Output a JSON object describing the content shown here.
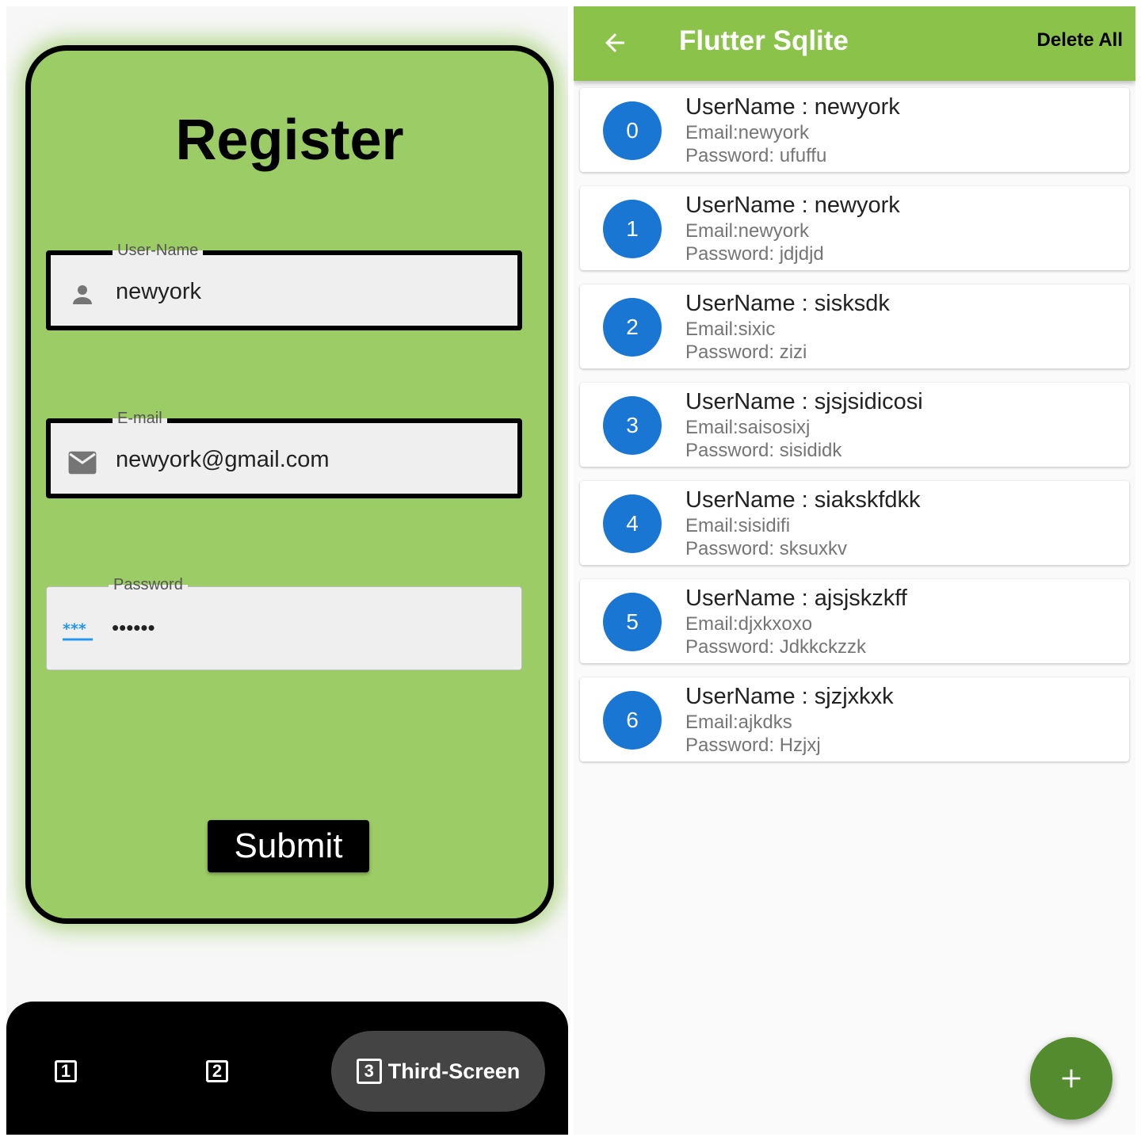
{
  "register": {
    "title": "Register",
    "fields": [
      {
        "label": "User-Name",
        "value": "newyork",
        "icon": "person-icon"
      },
      {
        "label": "E-mail",
        "value": "newyork@gmail.com",
        "icon": "email-icon"
      },
      {
        "label": "Password",
        "value": "••••••",
        "icon": "password-icon"
      }
    ],
    "submit_label": "Submit"
  },
  "bottom_nav": {
    "items": [
      {
        "badge": "1"
      },
      {
        "badge": "2"
      },
      {
        "badge": "3",
        "label": "Third-Screen",
        "active": true
      }
    ]
  },
  "app_bar": {
    "title": "Flutter Sqlite",
    "action_label": "Delete All"
  },
  "users": [
    {
      "index": "0",
      "name": "UserName : newyork",
      "email": "Email:newyork",
      "password": "Password: ufuffu"
    },
    {
      "index": "1",
      "name": "UserName : newyork",
      "email": "Email:newyork",
      "password": "Password: jdjdjd"
    },
    {
      "index": "2",
      "name": "UserName : sisksdk",
      "email": "Email:sixic",
      "password": "Password: zizi"
    },
    {
      "index": "3",
      "name": "UserName : sjsjsidicosi",
      "email": "Email:saisosixj",
      "password": "Password: sisididk"
    },
    {
      "index": "4",
      "name": "UserName : siakskfdkk",
      "email": "Email:sisidifi",
      "password": "Password: sksuxkv"
    },
    {
      "index": "5",
      "name": "UserName : ajsjskzkff",
      "email": "Email:djxkxoxo",
      "password": "Password: Jdkkckzzk"
    },
    {
      "index": "6",
      "name": "UserName : sjzjxkxk",
      "email": "Email:ajkdks",
      "password": "Password: Hzjxj"
    }
  ],
  "colors": {
    "card_green": "#9ccc65",
    "app_bar_green": "#8bc34a",
    "fab_green": "#558b2f",
    "avatar_blue": "#1976d2"
  }
}
